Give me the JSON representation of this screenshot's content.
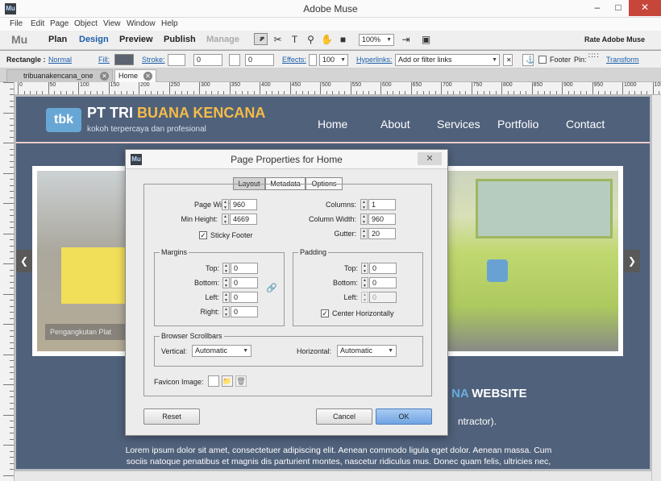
{
  "window": {
    "title": "Adobe Muse",
    "icon": "Mu"
  },
  "menu": [
    "File",
    "Edit",
    "Page",
    "Object",
    "View",
    "Window",
    "Help"
  ],
  "modes": {
    "logo": "Mu",
    "items": [
      "Plan",
      "Design",
      "Preview",
      "Publish",
      "Manage"
    ],
    "active": "Design",
    "rate": "Rate Adobe Muse"
  },
  "zoom": "100%",
  "control": {
    "selection": "Rectangle :",
    "style": "Normal",
    "fill": "Fill:",
    "stroke": "Stroke:",
    "stroke_val": "0",
    "corner_val": "0",
    "effects": "Effects:",
    "opacity": "100",
    "hyperlinks": "Hyperlinks:",
    "link_placeholder": "Add or filter links",
    "footer": "Footer",
    "pin": "Pin:",
    "transform": "Transform"
  },
  "tabs": [
    {
      "label": "tribuanakencana_one"
    },
    {
      "label": "Home"
    }
  ],
  "ruler_labels": [
    "0",
    "50",
    "100",
    "150",
    "200",
    "250",
    "300",
    "350",
    "400",
    "450",
    "500",
    "550",
    "600",
    "650",
    "700",
    "750",
    "800",
    "850",
    "900",
    "950",
    "1000",
    "1050"
  ],
  "site": {
    "brand_a": "PT TRI ",
    "brand_b": "BUANA KENCANA",
    "tagline": "kokoh terpercaya dan profesional",
    "nav": [
      "Home",
      "About",
      "Services",
      "Portfolio",
      "Contact"
    ],
    "slide_caption": "Pengangkutan Plat",
    "heading_a": "NA",
    "heading_b": " WEBSITE",
    "paragraph": "ntractor).",
    "lorem1": "Lorem ipsum dolor sit amet, consectetuer adipiscing elit. Aenean commodo ligula eget dolor. Aenean massa. Cum",
    "lorem2": "sociis natoque penatibus et magnis dis parturient montes, nascetur ridiculus mus. Donec quam felis, ultricies nec,"
  },
  "dialog": {
    "title": "Page Properties for Home",
    "tabs": [
      "Layout",
      "Metadata",
      "Options"
    ],
    "page_width_label": "Page Width:",
    "page_width": "960",
    "min_height_label": "Min Height:",
    "min_height": "4669",
    "sticky_footer": "Sticky Footer",
    "columns_label": "Columns:",
    "columns": "1",
    "column_width_label": "Column Width:",
    "column_width": "960",
    "gutter_label": "Gutter:",
    "gutter": "20",
    "margins": {
      "title": "Margins",
      "top_label": "Top:",
      "top": "0",
      "bottom_label": "Bottom:",
      "bottom": "0",
      "left_label": "Left:",
      "left": "0",
      "right_label": "Right:",
      "right": "0"
    },
    "padding": {
      "title": "Padding",
      "top_label": "Top:",
      "top": "0",
      "bottom_label": "Bottom:",
      "bottom": "0",
      "left_label": "Left:",
      "left": "0",
      "center": "Center Horizontally"
    },
    "scrollbars": {
      "title": "Browser Scrollbars",
      "vertical_label": "Vertical:",
      "vertical": "Automatic",
      "horizontal_label": "Horizontal:",
      "horizontal": "Automatic"
    },
    "favicon_label": "Favicon Image:",
    "reset": "Reset",
    "cancel": "Cancel",
    "ok": "OK"
  }
}
